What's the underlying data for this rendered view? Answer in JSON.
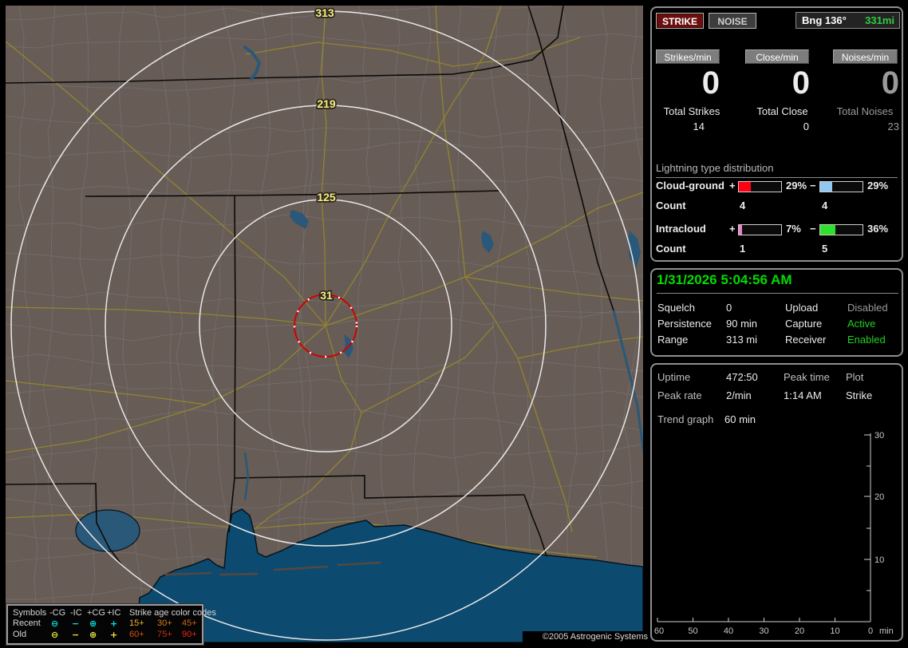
{
  "window": {
    "copyright": "©2005 Astrogenic Systems"
  },
  "map": {
    "range_ring_labels": [
      "313",
      "219",
      "125",
      "31"
    ],
    "ring_color": "#e8e8e8",
    "alarm_ring_color": "#d40000",
    "legend": {
      "symbols_header": "Symbols",
      "columns": [
        "-CG",
        "-IC",
        "+CG",
        "+IC"
      ],
      "age_header": "Strike age color codes",
      "rows": [
        {
          "label": "Recent",
          "symbol_color": "#00e0e0",
          "circle_minus": "⊖",
          "minus": "−",
          "circle_plus": "⊕",
          "plus": "+",
          "ages": [
            "15+",
            "30+",
            "45+"
          ],
          "age_colors": [
            "#f0b428",
            "#e07818",
            "#cc6214"
          ]
        },
        {
          "label": "Old",
          "symbol_color": "#e8e838",
          "circle_minus": "⊖",
          "minus": "−",
          "circle_plus": "⊕",
          "plus": "+",
          "ages": [
            "60+",
            "75+",
            "90+"
          ],
          "age_colors": [
            "#dd5010",
            "#cc3014",
            "#ee2414"
          ]
        }
      ]
    }
  },
  "panel": {
    "buttons": {
      "strike": "STRIKE",
      "noise": "NOISE"
    },
    "bearing": {
      "label": "Bng 136°",
      "distance": "331mi",
      "distance_color": "#2ecc40"
    },
    "rates": [
      {
        "label": "Strikes/min",
        "value": "0",
        "total_label": "Total Strikes",
        "total": "14"
      },
      {
        "label": "Close/min",
        "value": "0",
        "total_label": "Total Close",
        "total": "0"
      },
      {
        "label": "Noises/min",
        "value": "0",
        "total_label": "Total Noises",
        "total": "23"
      }
    ],
    "distribution": {
      "title": "Lightning type distribution",
      "plus_sign": "+",
      "minus_sign": "−",
      "rows": [
        {
          "label": "Cloud-ground",
          "plus_pct": "29%",
          "plus_fill": 29,
          "plus_color": "#ff0012",
          "minus_pct": "29%",
          "minus_fill": 29,
          "minus_color": "#90c8f0",
          "count_label": "Count",
          "plus_count": "4",
          "minus_count": "4"
        },
        {
          "label": "Intracloud",
          "plus_pct": "7%",
          "plus_fill": 7,
          "plus_color": "#ee82c8",
          "minus_pct": "36%",
          "minus_fill": 36,
          "minus_color": "#2ee02e",
          "count_label": "Count",
          "plus_count": "1",
          "minus_count": "5"
        }
      ]
    },
    "status": {
      "datetime": "1/31/2026 5:04:56 AM",
      "rows": [
        {
          "k1": "Squelch",
          "v1": "0",
          "k2": "Upload",
          "v2": "Disabled",
          "v2_state": "disabled"
        },
        {
          "k1": "Persistence",
          "v1": "90 min",
          "k2": "Capture",
          "v2": "Active",
          "v2_state": "active"
        },
        {
          "k1": "Range",
          "v1": "313 mi",
          "k2": "Receiver",
          "v2": "Enabled",
          "v2_state": "active"
        }
      ]
    },
    "stats": {
      "rows": [
        {
          "c1": "Uptime",
          "c2": "472:50",
          "c3": "Peak time",
          "c4": "Plot"
        },
        {
          "c1": "Peak rate",
          "c2": "2/min",
          "c3": "1:14 AM",
          "c4": "Strike"
        }
      ],
      "trend_label": "Trend graph",
      "trend_value": "60 min"
    },
    "chart": {
      "type": "line",
      "series": [],
      "y_ticks": [
        "30",
        "20",
        "10"
      ],
      "y_range": [
        0,
        30
      ],
      "x_ticks": [
        "60",
        "50",
        "40",
        "30",
        "20",
        "10",
        "0"
      ],
      "x_unit": "min",
      "note": "empty trend graph, no data plotted"
    }
  }
}
